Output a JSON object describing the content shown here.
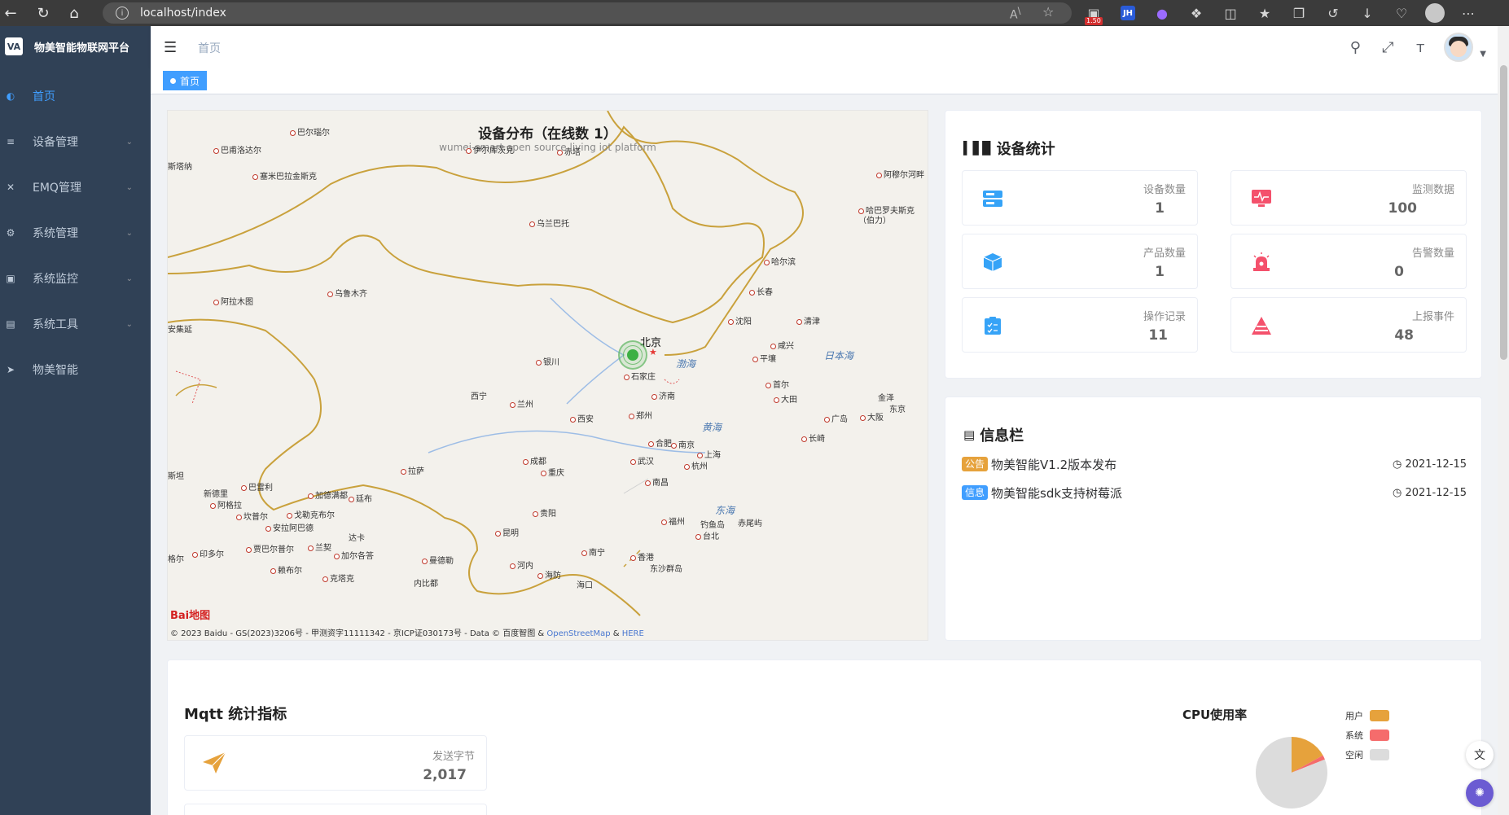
{
  "browser": {
    "url": "localhost/index",
    "read_aloud_label": "A",
    "badge": "1.50",
    "jh_label": "JH"
  },
  "sidebar": {
    "logo_text": "VA",
    "title": "物美智能物联网平台",
    "items": [
      {
        "label": "首页",
        "icon": "dashboard-icon",
        "active": true
      },
      {
        "label": "设备管理",
        "icon": "layers-icon",
        "has_children": true
      },
      {
        "label": "EMQ管理",
        "icon": "close-icon",
        "has_children": true
      },
      {
        "label": "系统管理",
        "icon": "gear-icon",
        "has_children": true
      },
      {
        "label": "系统监控",
        "icon": "monitor-icon",
        "has_children": true
      },
      {
        "label": "系统工具",
        "icon": "toolbox-icon",
        "has_children": true
      },
      {
        "label": "物美智能",
        "icon": "send-icon",
        "has_children": false
      }
    ]
  },
  "navbar": {
    "breadcrumb": "首页"
  },
  "tags_view": {
    "active_tag": "首页"
  },
  "map": {
    "title": "设备分布（在线数 1）",
    "subtitle": "wumei-smart open source living iot platform",
    "capital": "北京",
    "footer_text": "© 2023 Baidu - GS(2023)3206号 - 甲测资字11111342 - 京ICP证030173号 - Data © 百度智图 & ",
    "footer_link1": "OpenStreetMap",
    "footer_amp": " & ",
    "footer_link2": "HERE",
    "logo": "Bai地图",
    "cities": [
      "巴尔瑙尔",
      "巴甫洛达尔",
      "斯塔纳",
      "塞米巴拉金斯克",
      "伊尔库茨克",
      "赤塔",
      "阿穆尔河畔",
      "哈巴罗夫斯克（伯力）",
      "乌兰巴托",
      "哈尔滨",
      "长春",
      "乌鲁木齐",
      "阿拉木图",
      "沈阳",
      "清津",
      "安集延",
      "咸兴",
      "平壤",
      "银川",
      "石家庄",
      "首尔",
      "西宁",
      "兰州",
      "济南",
      "大田",
      "金泽",
      "东京",
      "西安",
      "郑州",
      "广岛",
      "大阪",
      "长崎",
      "合肥",
      "南京",
      "上海",
      "成都",
      "武汉",
      "杭州",
      "拉萨",
      "重庆",
      "南昌",
      "新德里",
      "巴雷利",
      "加德满都",
      "廷布",
      "阿格拉",
      "坎普尔",
      "戈勒克布尔",
      "安拉阿巴德",
      "贵阳",
      "福州",
      "钓鱼岛",
      "赤尾屿",
      "台北",
      "达卡",
      "昆明",
      "印多尔",
      "贾巴尔普尔",
      "兰契",
      "加尔各答",
      "南宁",
      "香港",
      "东沙群岛",
      "曼德勒",
      "河内",
      "海防",
      "海口",
      "格尔",
      "克塔克",
      "赖布尔",
      "内比都",
      "斯坦"
    ],
    "seas": [
      "渤海",
      "黄海",
      "东海",
      "日本海"
    ]
  },
  "stats": {
    "title": "设备统计",
    "items": [
      {
        "label": "设备数量",
        "value": "1",
        "icon": "server-icon",
        "color": "#36a3f7"
      },
      {
        "label": "监测数据",
        "value": "100",
        "icon": "monitor-pulse-icon",
        "color": "#f4516c"
      },
      {
        "label": "产品数量",
        "value": "1",
        "icon": "cube-icon",
        "color": "#36a3f7"
      },
      {
        "label": "告警数量",
        "value": "0",
        "icon": "alarm-icon",
        "color": "#f4516c"
      },
      {
        "label": "操作记录",
        "value": "11",
        "icon": "clipboard-icon",
        "color": "#36a3f7"
      },
      {
        "label": "上报事件",
        "value": "48",
        "icon": "warning-icon",
        "color": "#f4516c"
      }
    ]
  },
  "info": {
    "title": "信息栏",
    "items": [
      {
        "tag": "公告",
        "tag_color": "#e6a23c",
        "text": "物美智能V1.2版本发布",
        "date": "2021-12-15"
      },
      {
        "tag": "信息",
        "tag_color": "#409eff",
        "text": "物美智能sdk支持树莓派",
        "date": "2021-12-15"
      }
    ]
  },
  "mqtt": {
    "title": "Mqtt 统计指标",
    "box_label": "发送字节",
    "box_value": "2,017"
  },
  "cpu": {
    "title": "CPU使用率",
    "legend": [
      {
        "name": "用户",
        "color": "#e6a23c"
      },
      {
        "name": "系统",
        "color": "#f56c6c"
      },
      {
        "name": "空闲",
        "color": "#dcdcdc"
      }
    ],
    "values": {
      "user": 0.17,
      "system": 0.02,
      "idle": 0.81
    }
  }
}
